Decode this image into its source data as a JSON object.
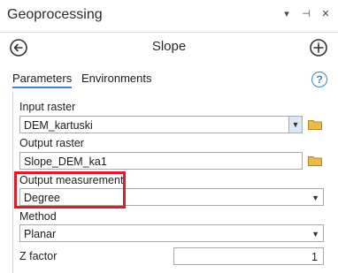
{
  "window": {
    "title": "Geoprocessing",
    "controls": [
      "▾",
      "⊣",
      "✕"
    ]
  },
  "tool": {
    "title": "Slope",
    "back_icon": "back-arrow-icon",
    "add_icon": "add-icon"
  },
  "tabs": [
    {
      "label": "Parameters",
      "active": true
    },
    {
      "label": "Environments",
      "active": false
    }
  ],
  "help_label": "?",
  "params": {
    "input_raster": {
      "label": "Input raster",
      "value": "DEM_kartuski"
    },
    "output_raster": {
      "label": "Output raster",
      "value": "Slope_DEM_ka1"
    },
    "output_measurement": {
      "label": "Output measurement",
      "value": "Degree"
    },
    "method": {
      "label": "Method",
      "value": "Planar"
    },
    "z_factor": {
      "label": "Z factor",
      "value": "1"
    }
  },
  "colors": {
    "accent": "#3a86c8",
    "highlight": "#d9202a",
    "folder": "#e9b949"
  }
}
